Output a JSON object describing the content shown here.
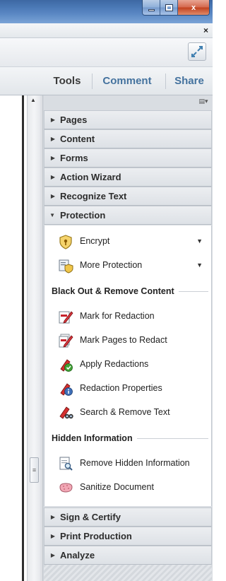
{
  "window": {
    "min_icon": "minimize-icon",
    "max_icon": "maximize-icon",
    "close_glyph": "x",
    "doc_close_glyph": "×"
  },
  "tabs": {
    "tools": "Tools",
    "comment": "Comment",
    "share": "Share"
  },
  "sections_top": [
    "Pages",
    "Content",
    "Forms",
    "Action Wizard",
    "Recognize Text"
  ],
  "protection": {
    "title": "Protection",
    "items": [
      {
        "label": "Encrypt",
        "icon": "shield-key-icon",
        "has_dropdown": true
      },
      {
        "label": "More Protection",
        "icon": "certificate-shield-icon",
        "has_dropdown": true
      }
    ],
    "groups": [
      {
        "title": "Black Out & Remove Content",
        "items": [
          {
            "label": "Mark for Redaction",
            "icon": "pencil-redaction-icon"
          },
          {
            "label": "Mark Pages to Redact",
            "icon": "pencil-pages-icon"
          },
          {
            "label": "Apply Redactions",
            "icon": "marker-check-icon"
          },
          {
            "label": "Redaction Properties",
            "icon": "marker-info-icon"
          },
          {
            "label": "Search & Remove Text",
            "icon": "marker-binoculars-icon"
          }
        ]
      },
      {
        "title": "Hidden Information",
        "items": [
          {
            "label": "Remove Hidden Information",
            "icon": "page-magnifier-icon"
          },
          {
            "label": "Sanitize Document",
            "icon": "sponge-icon"
          }
        ]
      }
    ]
  },
  "sections_bottom": [
    "Sign & Certify",
    "Print Production",
    "Analyze"
  ],
  "colors": {
    "title_bar": "#4a78b5",
    "tab_blue": "#44729e",
    "close_red": "#c2421f",
    "pane_bg": "#d9dde2"
  }
}
